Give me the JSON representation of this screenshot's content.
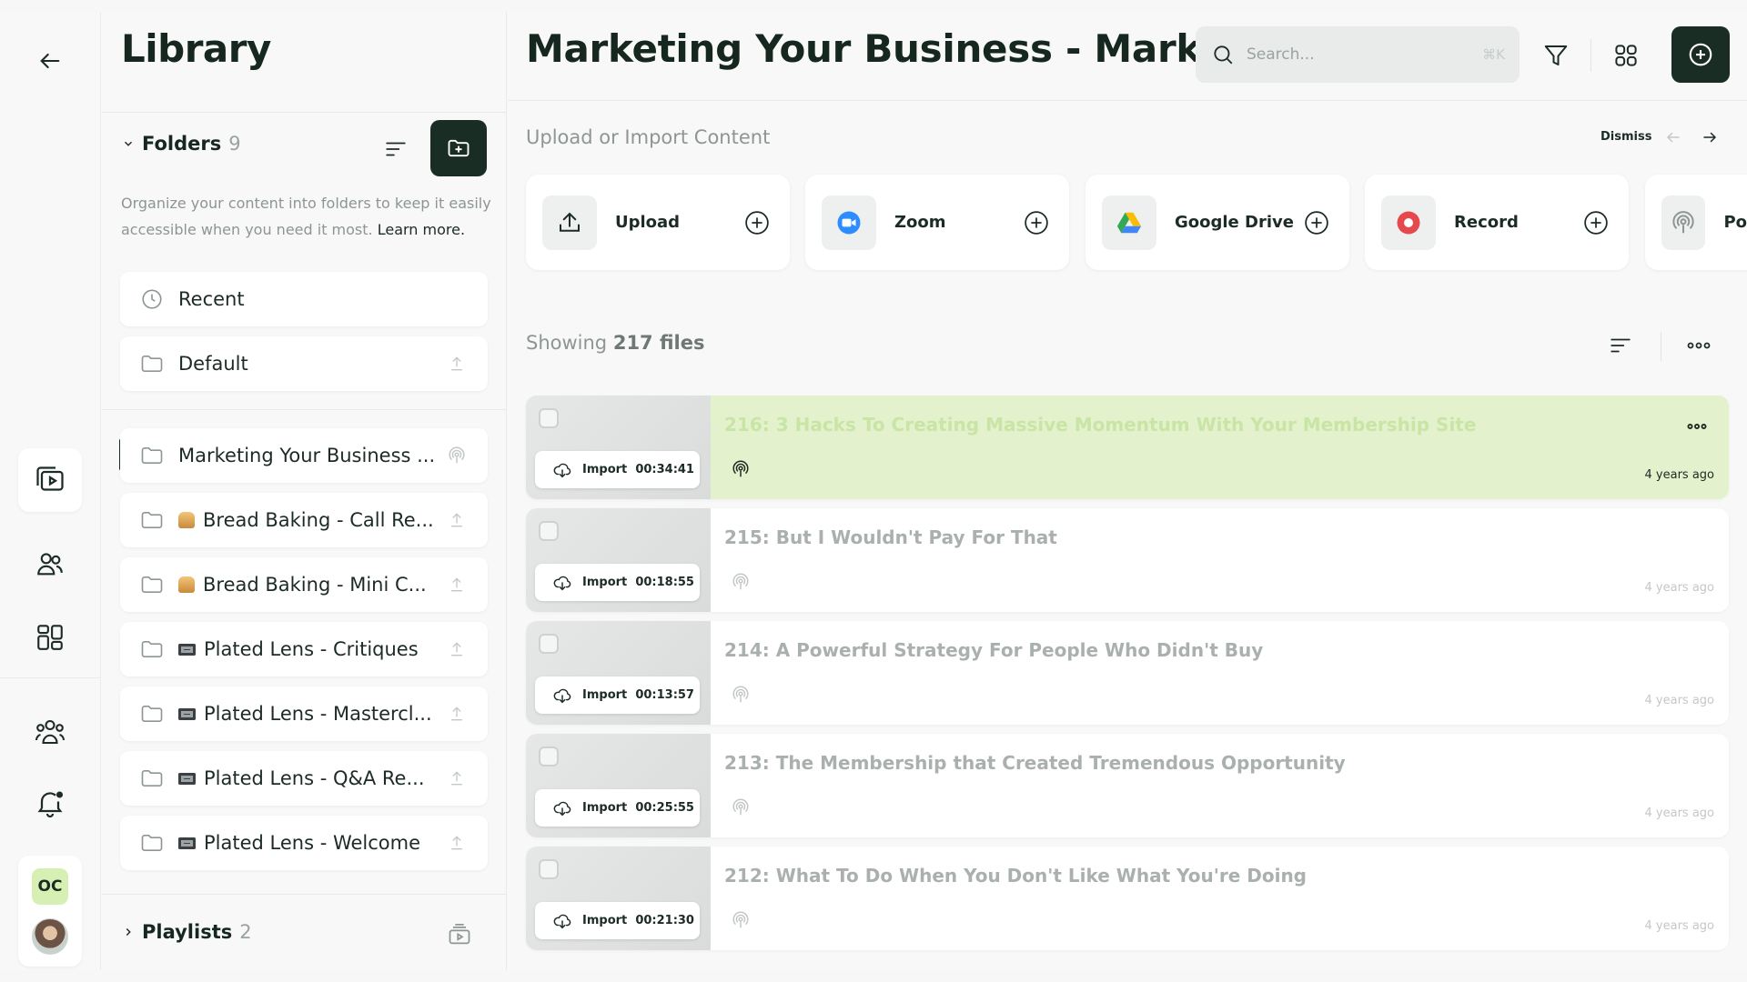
{
  "library": {
    "title": "Library",
    "folders_label": "Folders",
    "folders_count": "9",
    "help_text": "Organize your content into folders to keep it easily accessible when you need it most.",
    "learn_more": "Learn more.",
    "pinned": [
      {
        "label": "Recent",
        "icon": "clock-icon"
      },
      {
        "label": "Default",
        "icon": "folder-icon",
        "action": "upload-icon"
      }
    ],
    "folders": [
      {
        "label": "Marketing Your Business ...",
        "emoji": "",
        "action": "podcast-icon"
      },
      {
        "label": "Bread Baking - Call Re...",
        "emoji": "bread",
        "action": "upload-icon"
      },
      {
        "label": "Bread Baking - Mini C...",
        "emoji": "bread",
        "action": "upload-icon"
      },
      {
        "label": "Plated Lens - Critiques",
        "emoji": "cam",
        "action": "upload-icon"
      },
      {
        "label": "Plated Lens - Mastercl...",
        "emoji": "cam",
        "action": "upload-icon"
      },
      {
        "label": "Plated Lens - Q&A Re...",
        "emoji": "cam",
        "action": "upload-icon"
      },
      {
        "label": "Plated Lens - Welcome",
        "emoji": "cam",
        "action": "upload-icon"
      }
    ],
    "playlists_label": "Playlists",
    "playlists_count": "2"
  },
  "user": {
    "initials": "OC"
  },
  "main": {
    "title": "Marketing Your Business - Marke...",
    "search_placeholder": "Search...",
    "search_shortcut": "⌘K",
    "upload_title": "Upload or Import Content",
    "dismiss": "Dismiss",
    "sources": [
      {
        "label": "Upload",
        "icon": "upload-arrow-icon"
      },
      {
        "label": "Zoom",
        "icon": "zoom-icon"
      },
      {
        "label": "Google Drive",
        "icon": "google-drive-icon"
      },
      {
        "label": "Record",
        "icon": "record-icon"
      },
      {
        "label": "Po",
        "icon": "podcast-icon"
      }
    ],
    "showing_prefix": "Showing",
    "showing_count": "217 files",
    "import_label": "Import",
    "files": [
      {
        "title": "216: 3 Hacks To Creating Massive Momentum With Your Membership Site",
        "duration": "00:34:41",
        "age": "4 years ago",
        "active": true
      },
      {
        "title": "215: But I Wouldn't Pay For That",
        "duration": "00:18:55",
        "age": "4 years ago",
        "active": false
      },
      {
        "title": "214: A Powerful Strategy For People Who Didn't Buy",
        "duration": "00:13:57",
        "age": "4 years ago",
        "active": false
      },
      {
        "title": "213: The Membership that Created Tremendous Opportunity",
        "duration": "00:25:55",
        "age": "4 years ago",
        "active": false
      },
      {
        "title": "212: What To Do When You Don't Like What You're Doing",
        "duration": "00:21:30",
        "age": "4 years ago",
        "active": false
      }
    ]
  },
  "colors": {
    "accent_dark": "#1a2d25",
    "active_row": "#e3f1cc",
    "record_red": "#e5484d",
    "zoom_blue": "#2d8cff"
  }
}
